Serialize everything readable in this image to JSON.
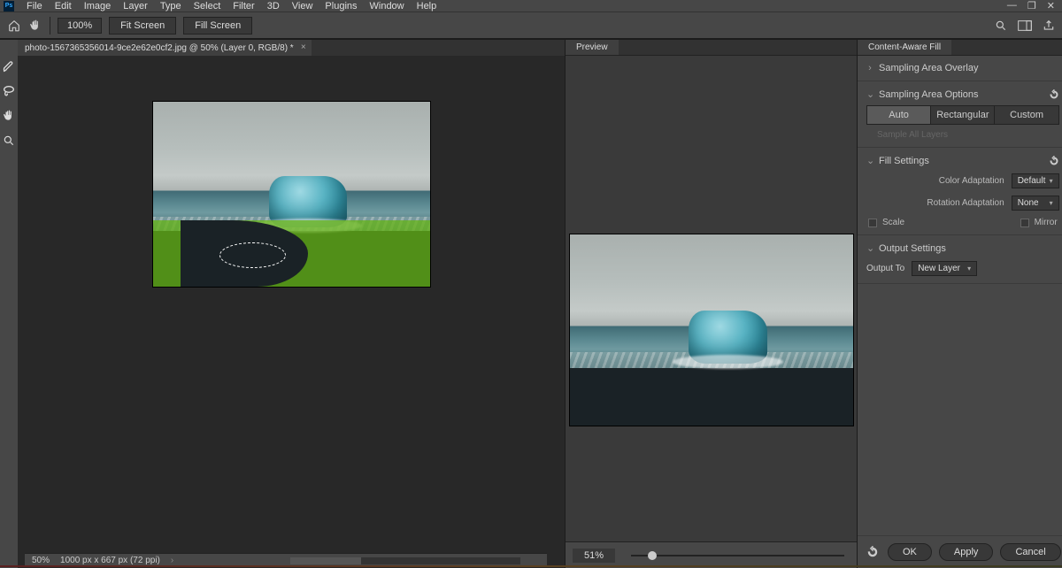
{
  "app": {
    "logo": "Ps"
  },
  "menus": [
    "File",
    "Edit",
    "Image",
    "Layer",
    "Type",
    "Select",
    "Filter",
    "3D",
    "View",
    "Plugins",
    "Window",
    "Help"
  ],
  "options": {
    "zoom": "100%",
    "fit1": "Fit Screen",
    "fit2": "Fill Screen"
  },
  "doc": {
    "tab": "photo-1567365356014-9ce2e62e0cf2.jpg @ 50% (Layer 0, RGB/8) *"
  },
  "preview": {
    "tab": "Preview",
    "zoom": "51%"
  },
  "caf": {
    "tab": "Content-Aware Fill",
    "sampling_overlay": "Sampling Area Overlay",
    "sampling_options": "Sampling Area Options",
    "seg": {
      "auto": "Auto",
      "rect": "Rectangular",
      "custom": "Custom"
    },
    "sample_all": "Sample All Layers",
    "fill_settings": "Fill Settings",
    "color_adapt": {
      "label": "Color Adaptation",
      "value": "Default"
    },
    "rot_adapt": {
      "label": "Rotation Adaptation",
      "value": "None"
    },
    "scale": "Scale",
    "mirror": "Mirror",
    "output_settings": "Output Settings",
    "output_to": {
      "label": "Output To",
      "value": "New Layer"
    }
  },
  "buttons": {
    "ok": "OK",
    "apply": "Apply",
    "cancel": "Cancel"
  },
  "status": {
    "zoom": "50%",
    "dims": "1000 px x 667 px (72 ppi)"
  }
}
